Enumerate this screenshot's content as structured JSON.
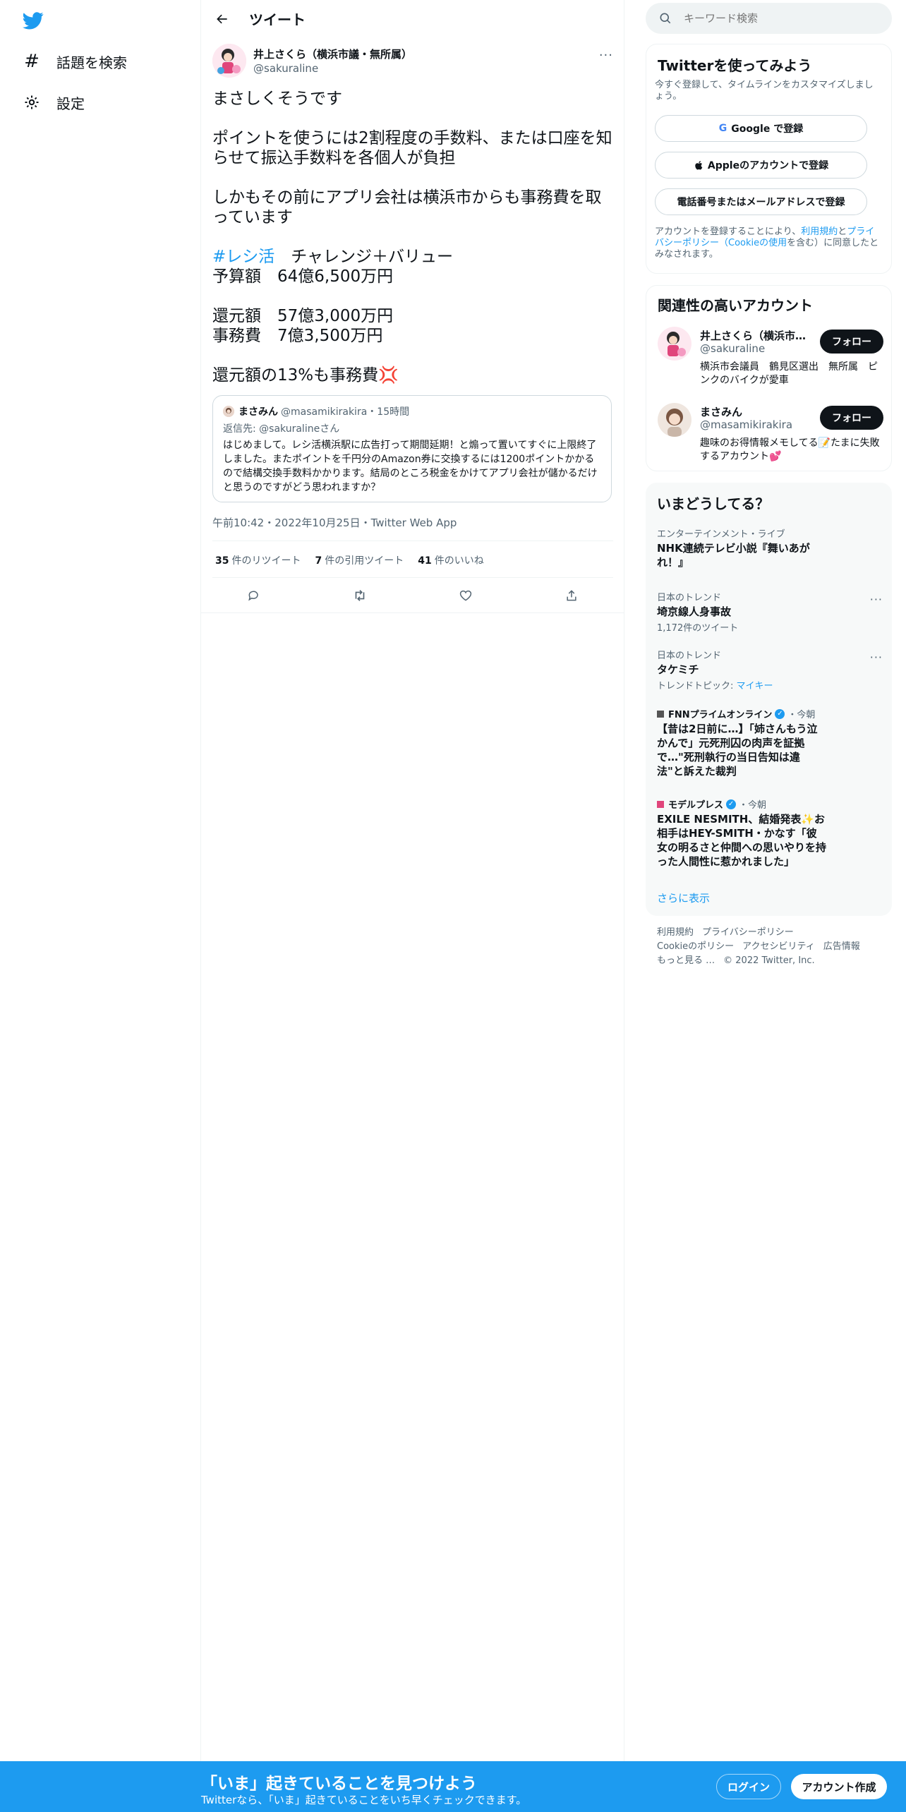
{
  "nav": {
    "items": [
      {
        "label": "話題を検索",
        "icon": "hash-icon"
      },
      {
        "label": "設定",
        "icon": "gear-icon"
      }
    ]
  },
  "header": {
    "title": "ツイート"
  },
  "tweet": {
    "author_name": "井上さくら（横浜市議・無所属）",
    "author_handle": "@sakuraline",
    "paragraphs": [
      "まさしくそうです",
      "ポイントを使うには2割程度の手数料、または口座を知らせて振込手数料を各個人が負担",
      "しかもその前にアプリ会社は横浜市からも事務費を取っています"
    ],
    "hashtag": "#レシ活",
    "hashtag_rest": "　チャレンジ＋バリュー",
    "line_budget": "予算額　64億6,500万円",
    "line_return": "還元額　57億3,000万円",
    "line_admin": "事務費　7億3,500万円",
    "line_ratio": "還元額の13%も事務費💢",
    "timestamp": "午前10:42・2022年10月25日・Twitter Web App",
    "stats": {
      "retweets_count": "35",
      "retweets_label": "件のリツイート",
      "quotes_count": "7",
      "quotes_label": "件の引用ツイート",
      "likes_count": "41",
      "likes_label": "件のいいね"
    }
  },
  "quote": {
    "name": "まさみん",
    "handle_time": "@masamikirakira・15時間",
    "reply_to": "返信先: @sakuralineさん",
    "text": "はじめまして。レシ活横浜駅に広告打って期間延期！と煽って置いてすぐに上限終了しました。またポイントを千円分のAmazon券に交換するには1200ポイントかかるので結構交換手数料かかります。結局のところ税金をかけてアプリ会社が儲かるだけと思うのですがどう思われますか？"
  },
  "search": {
    "placeholder": "キーワード検索"
  },
  "signup_panel": {
    "title": "Twitterを使ってみよう",
    "subtitle": "今すぐ登録して、タイムラインをカスタマイズしましょう。",
    "google_label": "Google で登録",
    "apple_label": "Appleのアカウントで登録",
    "phone_label": "電話番号またはメールアドレスで登録",
    "terms_prefix": "アカウントを登録することにより、",
    "terms_link1": "利用規約",
    "terms_and": "と",
    "terms_link2": "プライバシーポリシー（Cookieの使用",
    "terms_suffix": "を含む）に同意したとみなされます。"
  },
  "related": {
    "title": "関連性の高いアカウント",
    "accounts": [
      {
        "name": "井上さくら（横浜市議・無所属）",
        "handle": "@sakuraline",
        "bio": "横浜市会議員　鶴見区選出　無所属　ピンクのバイクが愛車",
        "follow": "フォロー"
      },
      {
        "name": "まさみん",
        "handle": "@masamikirakira",
        "bio": "趣味のお得情報メモしてる📝たまに失敗するアカウント💕",
        "follow": "フォロー"
      }
    ]
  },
  "trends": {
    "title": "いまどうしてる？",
    "items": [
      {
        "context": "エンターテインメント・ライブ",
        "name": "NHK連続テレビ小説『舞いあがれ！』",
        "sub": ""
      },
      {
        "context": "日本のトレンド",
        "name": "埼京線人身事故",
        "sub": "1,172件のツイート"
      },
      {
        "context": "日本のトレンド",
        "name": "タケミチ",
        "sub_prefix": "トレンドトピック: ",
        "sub_link": "マイキー"
      }
    ],
    "news": [
      {
        "source": "FNNプライムオンライン",
        "time": "・今朝",
        "headline": "【昔は2日前に…】「姉さんもう泣かんで」元死刑囚の肉声を証拠で…\"死刑執行の当日告知は違法\"と訴えた裁判"
      },
      {
        "source": "モデルプレス",
        "time": "・今朝",
        "headline": "EXILE NESMITH、結婚発表✨お相手はHEY-SMITH・かなす「彼女の明るさと仲間への思いやりを持った人間性に惹かれました」"
      }
    ],
    "show_more": "さらに表示"
  },
  "footer": {
    "links": [
      "利用規約",
      "プライバシーポリシー",
      "Cookieのポリシー",
      "アクセシビリティ",
      "広告情報",
      "もっと見る …"
    ],
    "copyright": "© 2022 Twitter, Inc."
  },
  "banner": {
    "title": "「いま」起きていることを見つけよう",
    "subtitle": "Twitterなら、「いま」起きていることをいち早くチェックできます。",
    "login": "ログイン",
    "signup": "アカウント作成"
  },
  "colors": {
    "accent": "#1d9bf0",
    "text": "#0f1419",
    "muted": "#536471"
  }
}
